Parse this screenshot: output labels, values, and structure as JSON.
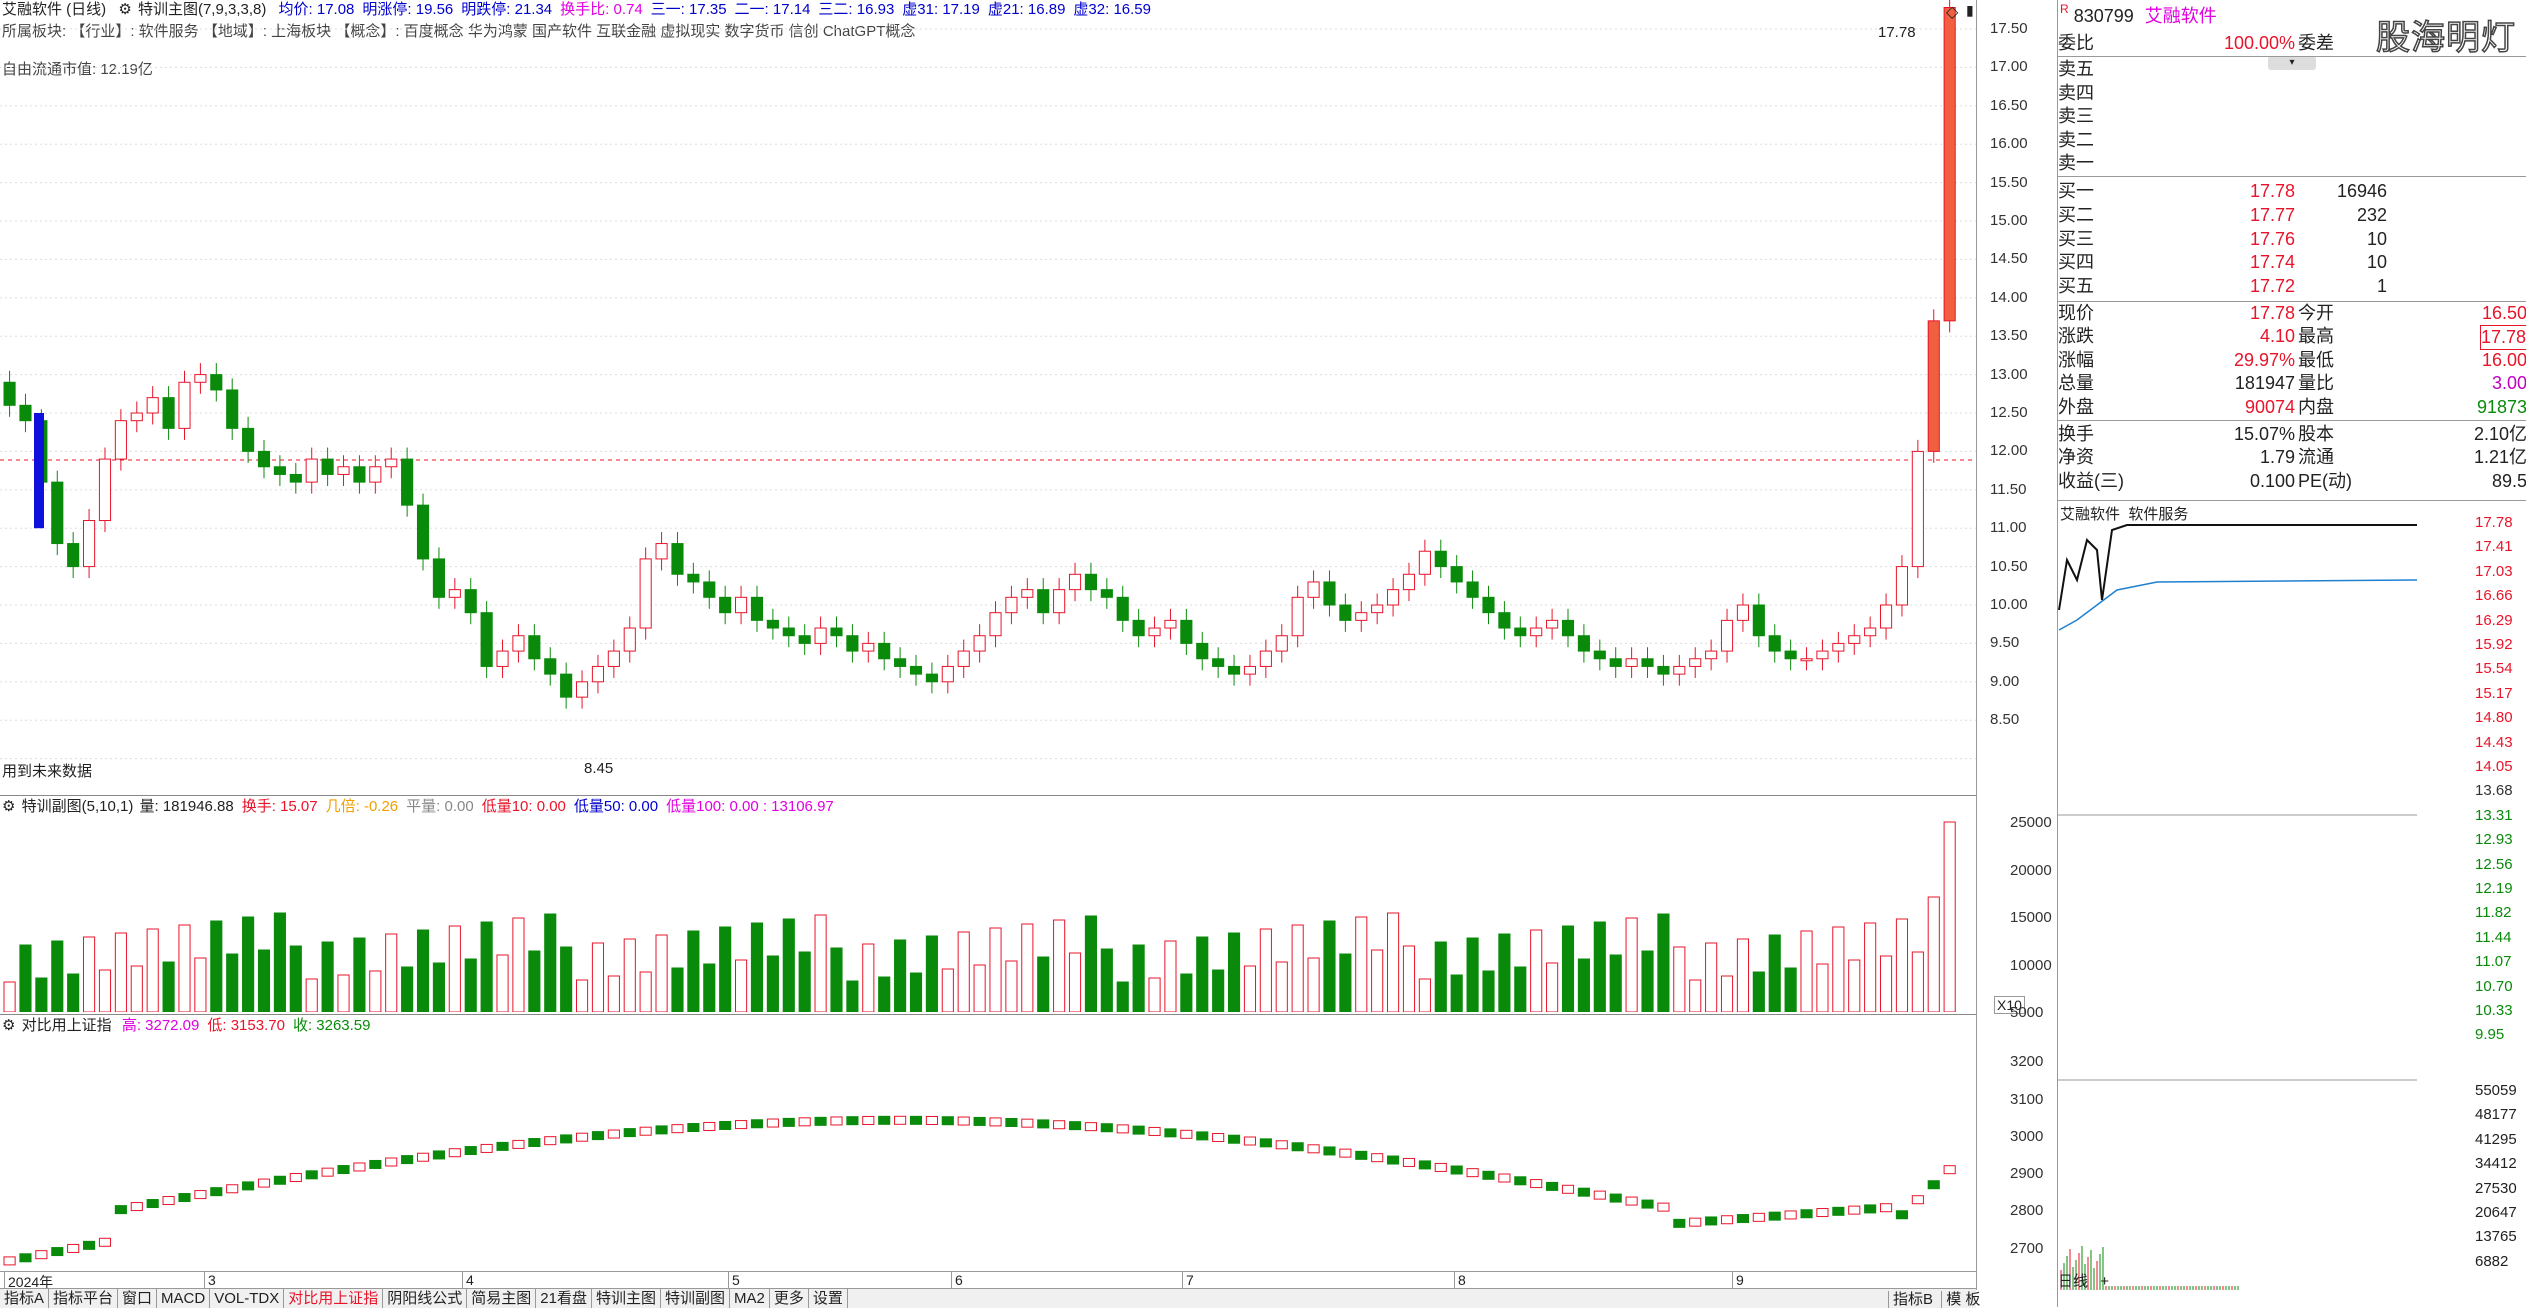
{
  "header": {
    "title": "艾融软件 (日线)",
    "indicator": "特训主图(7,9,3,3,8)",
    "items": [
      {
        "label": "均价: 17.08",
        "color": "#0000cc"
      },
      {
        "label": "明涨停: 19.56",
        "color": "#0000cc"
      },
      {
        "label": "明跌停: 21.34",
        "color": "#0000cc"
      },
      {
        "label": "换手比: 0.74",
        "color": "#e000e0"
      },
      {
        "label": "三一: 17.35",
        "color": "#0000cc"
      },
      {
        "label": "二一: 17.14",
        "color": "#0000cc"
      },
      {
        "label": "三二: 16.93",
        "color": "#0000cc"
      },
      {
        "label": "虚31: 17.19",
        "color": "#0000cc"
      },
      {
        "label": "虚21: 16.89",
        "color": "#0000cc"
      },
      {
        "label": "虚32: 16.59",
        "color": "#0000cc"
      }
    ],
    "line2": "所属板块: 【行业】: 软件服务     【地域】: 上海板块     【概念】: 百度概念 华为鸿蒙 国产软件 互联金融 虚拟现实 数字货币 信创 ChatGPT概念",
    "line3": "自由流通市值: 12.19亿",
    "future_label": "用到未来数据",
    "high_label": "17.78",
    "low_label": "8.45"
  },
  "price_axis": [
    "17.50",
    "17.00",
    "16.50",
    "16.00",
    "15.50",
    "15.00",
    "14.50",
    "14.00",
    "13.50",
    "13.00",
    "12.50",
    "12.00",
    "11.50",
    "11.00",
    "10.50",
    "10.00",
    "9.50",
    "9.00",
    "8.50"
  ],
  "vol_header": {
    "name": "特训副图(5,10,1)",
    "items": [
      {
        "label": "量: 181946.88",
        "color": "#222"
      },
      {
        "label": "换手: 15.07",
        "color": "#e8142a"
      },
      {
        "label": "几倍: -0.26",
        "color": "#f0a000"
      },
      {
        "label": "平量: 0.00",
        "color": "#888"
      },
      {
        "label": "低量10: 0.00",
        "color": "#e8142a"
      },
      {
        "label": "低量50: 0.00",
        "color": "#0000cc"
      },
      {
        "label": "低量100: 0.00 : 13106.97",
        "color": "#e000e0"
      }
    ]
  },
  "vol_axis": [
    "25000",
    "20000",
    "15000",
    "10000",
    "5000"
  ],
  "vol_unit": "X10",
  "index_header": {
    "name": "对比用上证指",
    "items": [
      {
        "label": "高: 3272.09",
        "color": "#e000e0"
      },
      {
        "label": "低: 3153.70",
        "color": "#e8142a"
      },
      {
        "label": "收: 3263.59",
        "color": "#0a8a0a"
      }
    ]
  },
  "index_axis": [
    "3200",
    "3100",
    "3000",
    "2900",
    "2800",
    "2700"
  ],
  "date_axis": [
    {
      "label": "2024年"
    },
    {
      "label": "3"
    },
    {
      "label": "4"
    },
    {
      "label": "5"
    },
    {
      "label": "6"
    },
    {
      "label": "7"
    },
    {
      "label": "8"
    },
    {
      "label": "9"
    }
  ],
  "bottom_tabs": [
    "指标A",
    "指标平台",
    "窗口",
    "MACD",
    "VOL-TDX",
    "对比用上证指",
    "阴阳线公式",
    "简易主图",
    "21看盘",
    "特训主图",
    "特训副图",
    "MA2",
    "更多",
    "设置"
  ],
  "bottom_right": {
    "tab1": "指标B",
    "tab2": "模 板"
  },
  "quote": {
    "code": "830799",
    "name": "艾融软件",
    "watermark": "股海明灯",
    "weibi_label": "委比",
    "weibi_value": "100.00%",
    "weicha_label": "委差",
    "sell": [
      "卖五",
      "卖四",
      "卖三",
      "卖二",
      "卖一"
    ],
    "buy": [
      {
        "label": "买一",
        "price": "17.78",
        "vol": "16946"
      },
      {
        "label": "买二",
        "price": "17.77",
        "vol": "232"
      },
      {
        "label": "买三",
        "price": "17.76",
        "vol": "10"
      },
      {
        "label": "买四",
        "price": "17.74",
        "vol": "10"
      },
      {
        "label": "买五",
        "price": "17.72",
        "vol": "1"
      }
    ],
    "stats": [
      {
        "l1": "现价",
        "v1": "17.78",
        "c1": "red",
        "l2": "今开",
        "v2": "16.50",
        "c2": "red"
      },
      {
        "l1": "涨跌",
        "v1": "4.10",
        "c1": "red",
        "l2": "最高",
        "v2": "17.78",
        "c2": "red"
      },
      {
        "l1": "涨幅",
        "v1": "29.97%",
        "c1": "red",
        "l2": "最低",
        "v2": "16.00",
        "c2": "red"
      },
      {
        "l1": "总量",
        "v1": "181947",
        "c1": "",
        "l2": "量比",
        "v2": "3.00",
        "c2": "pur"
      },
      {
        "l1": "外盘",
        "v1": "90074",
        "c1": "red",
        "l2": "内盘",
        "v2": "91873",
        "c2": "grn"
      },
      {
        "l1": "换手",
        "v1": "15.07%",
        "c1": "",
        "l2": "股本",
        "v2": "2.10亿",
        "c2": ""
      },
      {
        "l1": "净资",
        "v1": "1.79",
        "c1": "",
        "l2": "流通",
        "v2": "1.21亿",
        "c2": ""
      },
      {
        "l1": "收益(三)",
        "v1": "0.100",
        "c1": "",
        "l2": "PE(动)",
        "v2": "89.5",
        "c2": ""
      }
    ],
    "mini_title": "艾融软件  软件服务",
    "mini_axis": [
      "17.78",
      "17.41",
      "17.03",
      "16.66",
      "16.29",
      "15.92",
      "15.54",
      "15.17",
      "14.80",
      "14.43",
      "14.05",
      "13.68",
      "13.31",
      "12.93",
      "12.56",
      "12.19",
      "11.82",
      "11.44",
      "11.07",
      "10.70",
      "10.33",
      "9.95"
    ],
    "mini_vol_axis": [
      "55059",
      "48177",
      "41295",
      "34412",
      "27530",
      "20647",
      "13765",
      "6882"
    ],
    "mini_tabs": {
      "tab1": "日线",
      "tab2": "+"
    }
  }
}
